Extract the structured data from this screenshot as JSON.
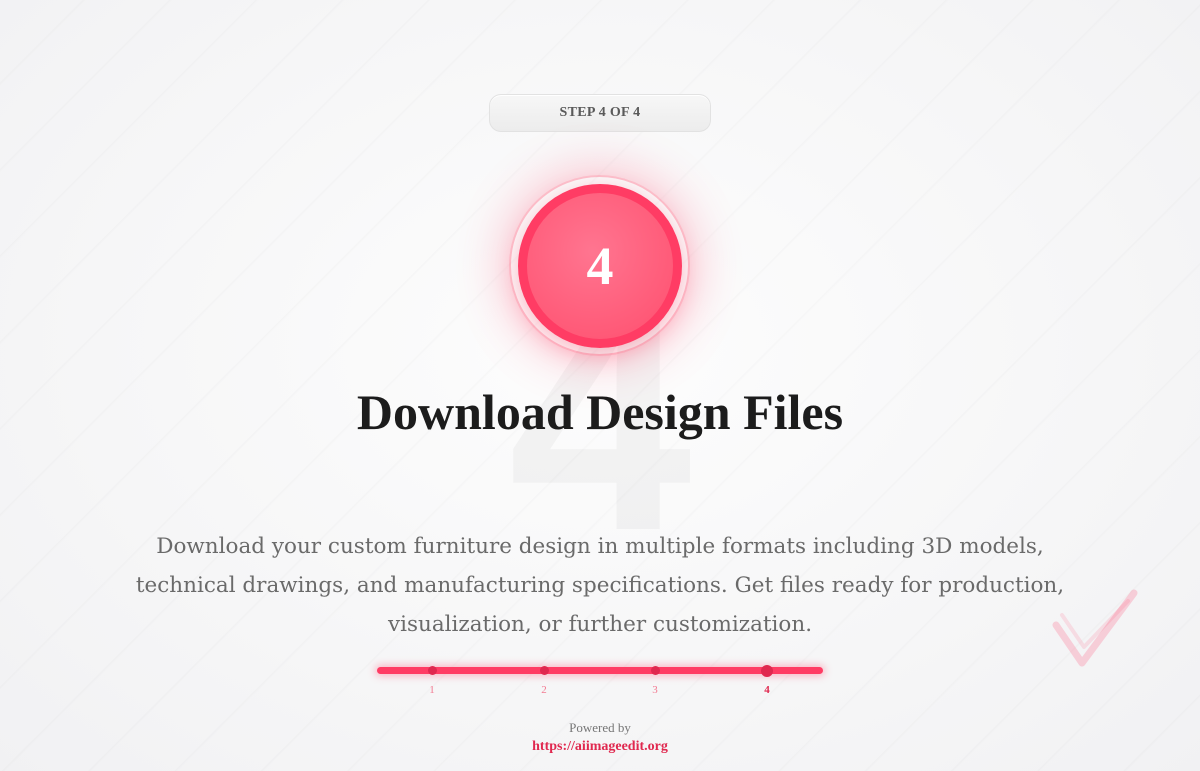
{
  "step_indicator": {
    "label": "STEP 4 OF 4"
  },
  "step_badge": {
    "number": "4",
    "background_numeral": "4"
  },
  "main": {
    "title": "Download Design Files",
    "description": "Download your custom furniture design in multiple formats including 3D models, technical drawings, and manufacturing specifications. Get files ready for production, visualization, or further customization."
  },
  "progress": {
    "steps": [
      "1",
      "2",
      "3",
      "4"
    ],
    "current_step": 4,
    "total_steps": 4,
    "fill_fraction": 1.0
  },
  "footer": {
    "powered_by": "Powered by",
    "link_text": "https://aiimageedit.org"
  },
  "colors": {
    "accent": "#ff3c64",
    "accent_dark": "#e0284f",
    "title": "#1c1c1c",
    "text": "#6a6a6a"
  },
  "icons": {
    "decoration": "checkmark-icon"
  }
}
